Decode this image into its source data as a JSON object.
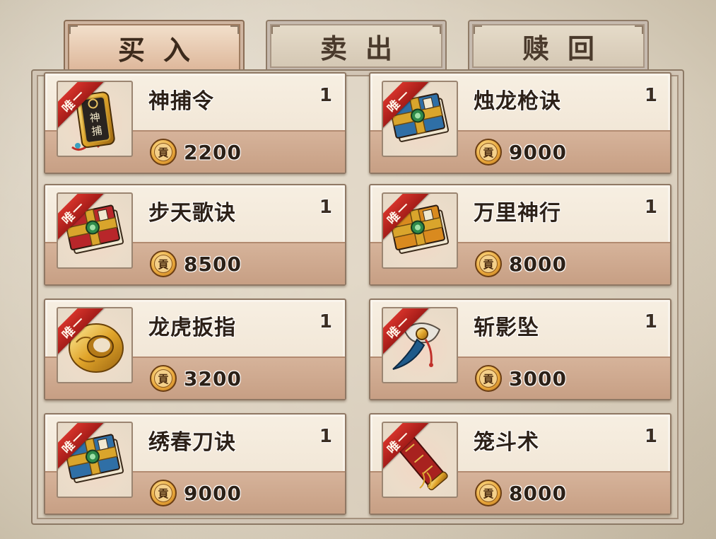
{
  "tabs": [
    {
      "label": "买入",
      "active": true
    },
    {
      "label": "卖出",
      "active": false
    },
    {
      "label": "赎回",
      "active": false
    }
  ],
  "badge_label": "唯一",
  "currency_icon": "coin-icon",
  "currency_glyph": "貢",
  "items": [
    {
      "name": "神捕令",
      "qty": "1",
      "price": "2200",
      "icon": "token-plaque-icon"
    },
    {
      "name": "烛龙枪诀",
      "qty": "1",
      "price": "9000",
      "icon": "blue-book-icon"
    },
    {
      "name": "步天歌诀",
      "qty": "1",
      "price": "8500",
      "icon": "red-book-icon"
    },
    {
      "name": "万里神行",
      "qty": "1",
      "price": "8000",
      "icon": "orange-book-icon"
    },
    {
      "name": "龙虎扳指",
      "qty": "1",
      "price": "3200",
      "icon": "gold-ring-icon"
    },
    {
      "name": "斩影坠",
      "qty": "1",
      "price": "3000",
      "icon": "blade-pendant-icon"
    },
    {
      "name": "绣春刀诀",
      "qty": "1",
      "price": "9000",
      "icon": "blue-book-icon"
    },
    {
      "name": "笼斗术",
      "qty": "1",
      "price": "8000",
      "icon": "scroll-icon"
    }
  ]
}
